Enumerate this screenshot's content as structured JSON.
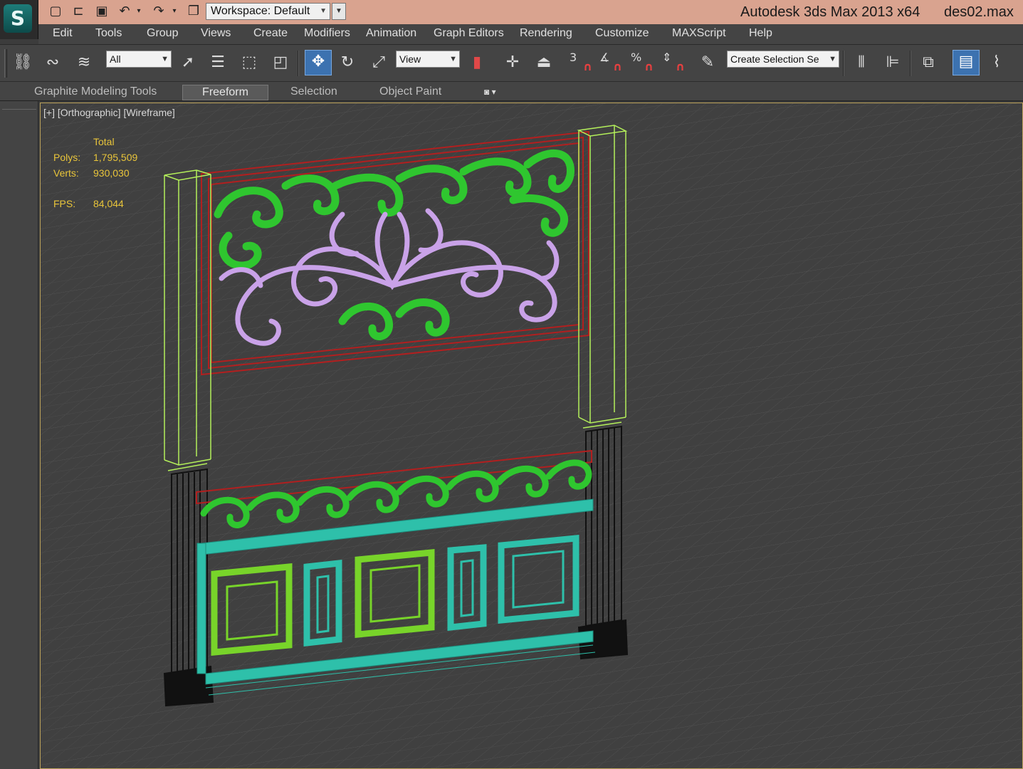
{
  "titlebar": {
    "workspace_label": "Workspace: Default",
    "app_title": "Autodesk 3ds Max  2013 x64",
    "file_name": "des02.max"
  },
  "quick_access": [
    "new-file-icon",
    "open-file-icon",
    "save-icon",
    "undo-icon",
    "redo-icon",
    "project-folder-icon"
  ],
  "menu": {
    "items": [
      "Edit",
      "Tools",
      "Group",
      "Views",
      "Create",
      "Modifiers",
      "Animation",
      "Graph Editors",
      "Rendering",
      "Customize",
      "MAXScript",
      "Help"
    ]
  },
  "toolbar": {
    "selection_filter": "All",
    "reference_coord": "View",
    "named_selection_placeholder": "Create Selection Se",
    "snap_labels": [
      "3",
      "%"
    ]
  },
  "ribbon": {
    "tabs": [
      "Graphite Modeling Tools",
      "Freeform",
      "Selection",
      "Object Paint"
    ],
    "active_tab": "Freeform"
  },
  "viewport": {
    "label": "[+] [Orthographic] [Wireframe]",
    "stats": {
      "total_label": "Total",
      "polys_label": "Polys:",
      "polys_value": "1,795,509",
      "verts_label": "Verts:",
      "verts_value": "930,030",
      "fps_label": "FPS:",
      "fps_value": "84,044"
    }
  },
  "colors": {
    "titlebar": "#d9a38f",
    "ui_dark": "#444444",
    "viewport_bg": "#404040",
    "stats_text": "#e9c53a",
    "wire_green": "#2fc62f",
    "wire_purple": "#c9a2e8",
    "wire_teal": "#2ec0aa",
    "wire_lime": "#78d42a",
    "wire_red": "#b21f1f",
    "wire_yellowgreen": "#b4f05a"
  }
}
